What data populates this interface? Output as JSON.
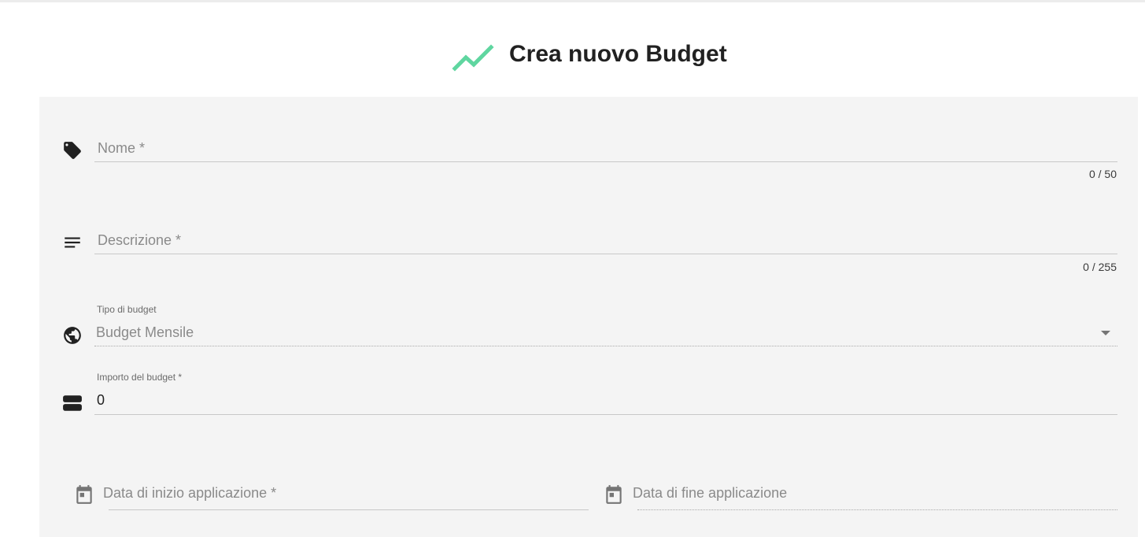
{
  "page": {
    "title": "Crea nuovo Budget",
    "title_icon": "trending-up-icon",
    "accent_color": "#5fd6a0"
  },
  "form": {
    "nome": {
      "placeholder": "Nome *",
      "value": "",
      "counter": "0 / 50",
      "icon": "tag-icon"
    },
    "descrizione": {
      "placeholder": "Descrizione *",
      "value": "",
      "counter": "0 / 255",
      "icon": "notes-icon"
    },
    "tipo": {
      "label": "Tipo di budget",
      "value": "Budget Mensile",
      "icon": "globe-icon"
    },
    "importo": {
      "label": "Importo del budget *",
      "value": "0",
      "icon": "money-icon"
    },
    "data_inizio": {
      "placeholder": "Data di inizio applicazione *",
      "icon": "calendar-icon"
    },
    "data_fine": {
      "placeholder": "Data di fine applicazione",
      "icon": "calendar-icon"
    }
  }
}
